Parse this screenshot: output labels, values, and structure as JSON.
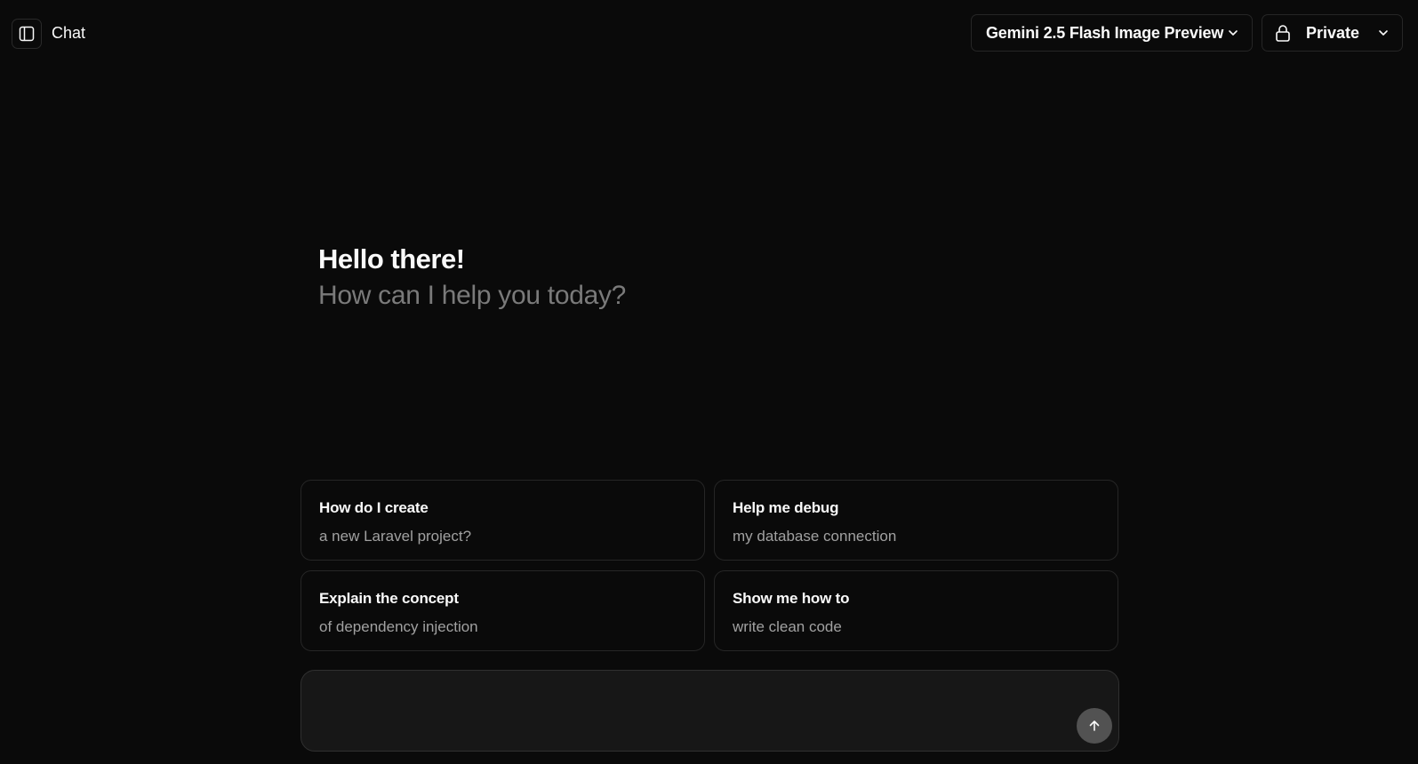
{
  "header": {
    "title": "Chat",
    "sidebar_toggle_icon": "sidebar-icon",
    "model_selector": {
      "label": "Gemini 2.5 Flash Image Preview",
      "icon": "chevron-down-icon"
    },
    "visibility_selector": {
      "label": "Private",
      "icon": "lock-icon",
      "caret_icon": "chevron-down-icon"
    }
  },
  "greeting": {
    "title": "Hello there!",
    "subtitle": "How can I help you today?"
  },
  "suggestions": [
    {
      "title": "How do I create",
      "subtitle": "a new Laravel project?"
    },
    {
      "title": "Help me debug",
      "subtitle": "my database connection"
    },
    {
      "title": "Explain the concept",
      "subtitle": "of dependency injection"
    },
    {
      "title": "Show me how to",
      "subtitle": "write clean code"
    }
  ],
  "composer": {
    "value": "",
    "send_icon": "arrow-up-icon"
  },
  "colors": {
    "background": "#0a0a0a",
    "border": "#262626",
    "muted_text": "#7a7a7a",
    "send_button": "#525252"
  }
}
